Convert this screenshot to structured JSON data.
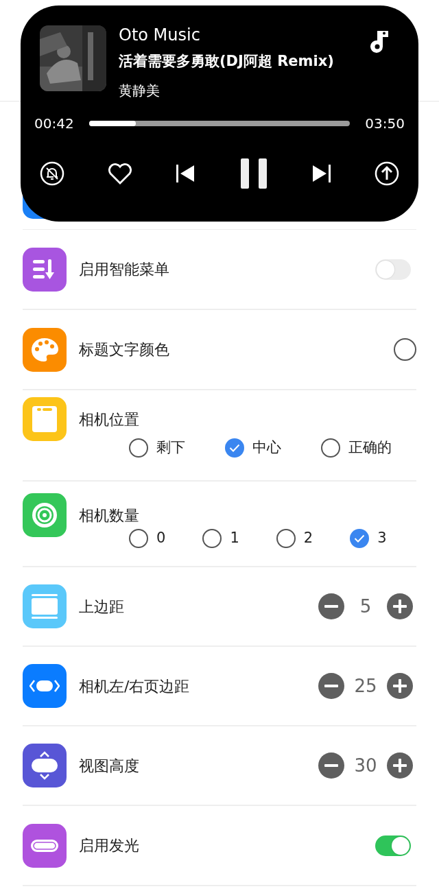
{
  "player": {
    "app": "Oto Music",
    "title": "活着需要多勇敢(DJ阿超 Remix)",
    "artist": "黄静美",
    "elapsed": "00:42",
    "duration": "03:50",
    "level": 0.18,
    "playing": true,
    "liked": false
  },
  "settings": [
    {
      "kind": "toggle",
      "label": "启用智能菜单",
      "color": "#a855e0",
      "on": false
    },
    {
      "kind": "swatch",
      "label": "标题文字颜色",
      "color": "#fb8c00"
    },
    {
      "kind": "choice",
      "label": "相机位置",
      "color": "#fcc419",
      "options": [
        {
          "label": "剩下",
          "selected": false
        },
        {
          "label": "中心",
          "selected": true
        },
        {
          "label": "正确的",
          "selected": false
        }
      ]
    },
    {
      "kind": "choice",
      "label": "相机数量",
      "color": "#34c759",
      "options": [
        {
          "label": "0",
          "selected": false
        },
        {
          "label": "1",
          "selected": false
        },
        {
          "label": "2",
          "selected": false
        },
        {
          "label": "3",
          "selected": true
        }
      ]
    },
    {
      "kind": "stepper",
      "label": "上边距",
      "color": "#5ac8fa",
      "value": "5"
    },
    {
      "kind": "stepper",
      "label": "相机左/右页边距",
      "color": "#0a7cff",
      "value": "25"
    },
    {
      "kind": "stepper",
      "label": "视图高度",
      "color": "#5856d6",
      "value": "30"
    },
    {
      "kind": "toggle",
      "label": "启用发光",
      "color": "#af52de",
      "on": true
    }
  ]
}
